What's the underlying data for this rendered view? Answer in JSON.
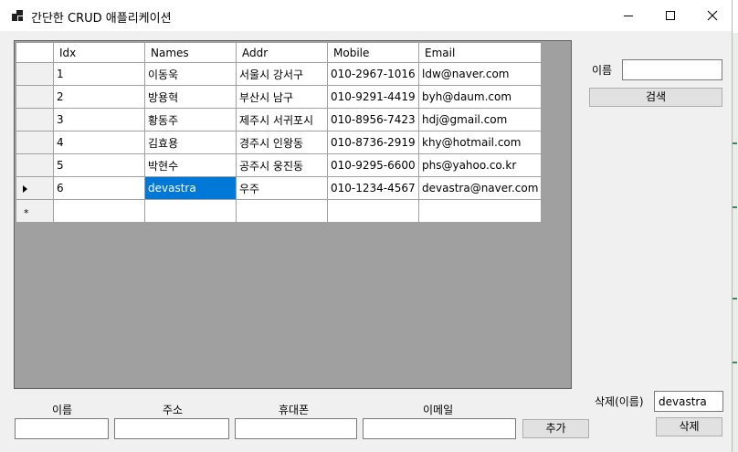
{
  "window": {
    "title": "간단한 CRUD 애플리케이션",
    "icon": "app-window-icon"
  },
  "grid": {
    "columns": [
      "Idx",
      "Names",
      "Addr",
      "Mobile",
      "Email"
    ],
    "rows": [
      {
        "idx": "1",
        "name": "이동욱",
        "addr": "서울시 강서구",
        "mobile": "010-2967-1016",
        "email": "ldw@naver.com"
      },
      {
        "idx": "2",
        "name": "방용혁",
        "addr": "부산시 남구",
        "mobile": "010-9291-4419",
        "email": "byh@daum.com"
      },
      {
        "idx": "3",
        "name": "황동주",
        "addr": "제주시 서귀포시",
        "mobile": "010-8956-7423",
        "email": "hdj@gmail.com"
      },
      {
        "idx": "4",
        "name": "김효용",
        "addr": "경주시 인왕동",
        "mobile": "010-8736-2919",
        "email": "khy@hotmail.com"
      },
      {
        "idx": "5",
        "name": "박현수",
        "addr": "공주시 웅진동",
        "mobile": "010-9295-6600",
        "email": "phs@yahoo.co.kr"
      },
      {
        "idx": "6",
        "name": "devastra",
        "addr": "우주",
        "mobile": "010-1234-4567",
        "email": "devastra@naver.com"
      }
    ],
    "current_row_marker": "row-arrow-icon",
    "new_row_marker": "*"
  },
  "search": {
    "label": "이름",
    "value": "",
    "button": "검색"
  },
  "add_form": {
    "name_label": "이름",
    "addr_label": "주소",
    "phone_label": "휴대폰",
    "email_label": "이메일",
    "name_value": "",
    "addr_value": "",
    "phone_value": "",
    "email_value": "",
    "button": "추가"
  },
  "delete": {
    "label": "삭제(이름)",
    "value": "devastra",
    "button": "삭제"
  },
  "colors": {
    "selection": "#0078d7",
    "grid_background": "#a0a0a0",
    "window_background": "#f0f0f0"
  }
}
